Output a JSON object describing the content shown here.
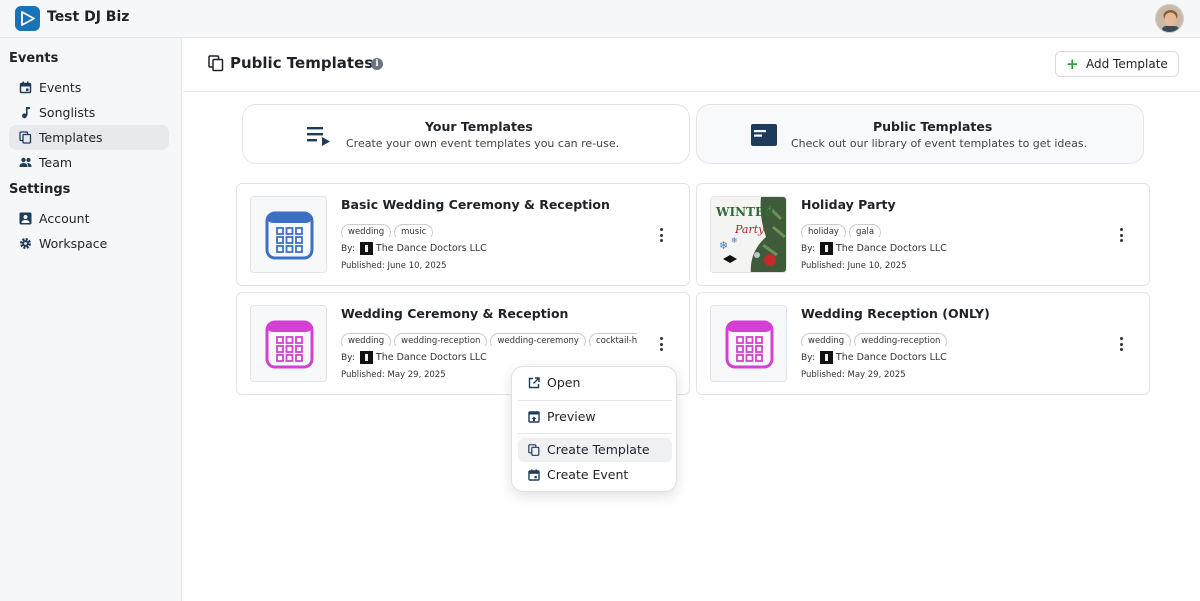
{
  "app": {
    "name": "Test DJ Biz"
  },
  "sidebar": {
    "sections": [
      {
        "label": "Events",
        "items": [
          {
            "label": "Events",
            "icon": "calendar-icon"
          },
          {
            "label": "Songlists",
            "icon": "music-note-icon"
          },
          {
            "label": "Templates",
            "icon": "copy-icon",
            "active": true
          },
          {
            "label": "Team",
            "icon": "people-icon"
          }
        ]
      },
      {
        "label": "Settings",
        "items": [
          {
            "label": "Account",
            "icon": "account-box-icon"
          },
          {
            "label": "Workspace",
            "icon": "gear-icon"
          }
        ]
      }
    ]
  },
  "header": {
    "title": "Public Templates",
    "add_label": "Add Template"
  },
  "modes": [
    {
      "title": "Your Templates",
      "desc": "Create your own event templates you can re-use.",
      "icon": "playlist-icon"
    },
    {
      "title": "Public Templates",
      "desc": "Check out our library of event templates to get ideas.",
      "icon": "web-icon"
    }
  ],
  "templates": [
    {
      "title": "Basic Wedding Ceremony & Reception",
      "tags": [
        "wedding",
        "music"
      ],
      "by_label": "By:",
      "org": "The Dance Doctors LLC",
      "published": "Published: June 10, 2025",
      "thumb": "calendar-blue",
      "accent": "#3d6fc4"
    },
    {
      "title": "Holiday Party",
      "tags": [
        "holiday",
        "gala"
      ],
      "by_label": "By:",
      "org": "The Dance Doctors LLC",
      "published": "Published: June 10, 2025",
      "thumb": "winter-party",
      "thumb_text": [
        "WINTER",
        "Party"
      ]
    },
    {
      "title": "Wedding Ceremony & Reception",
      "tags": [
        "wedding",
        "wedding-reception",
        "wedding-ceremony",
        "cocktail-ho"
      ],
      "by_label": "By:",
      "org": "The Dance Doctors LLC",
      "published": "Published: May 29, 2025",
      "thumb": "calendar-magenta",
      "accent": "#d63fd3"
    },
    {
      "title": "Wedding Reception (ONLY)",
      "tags": [
        "wedding",
        "wedding-reception"
      ],
      "by_label": "By:",
      "org": "The Dance Doctors LLC",
      "published": "Published: May 29, 2025",
      "thumb": "calendar-magenta",
      "accent": "#d63fd3"
    }
  ],
  "menu": {
    "items": [
      {
        "label": "Open",
        "icon": "open-external-icon"
      },
      {
        "label": "Preview",
        "icon": "preview-icon"
      },
      {
        "label": "Create Template",
        "icon": "copy-icon",
        "hover": true
      },
      {
        "label": "Create Event",
        "icon": "calendar-icon"
      }
    ]
  },
  "colors": {
    "brand": "#1a73b8",
    "add_plus": "#2ea043",
    "nav_icon": "#1f3b5c"
  }
}
